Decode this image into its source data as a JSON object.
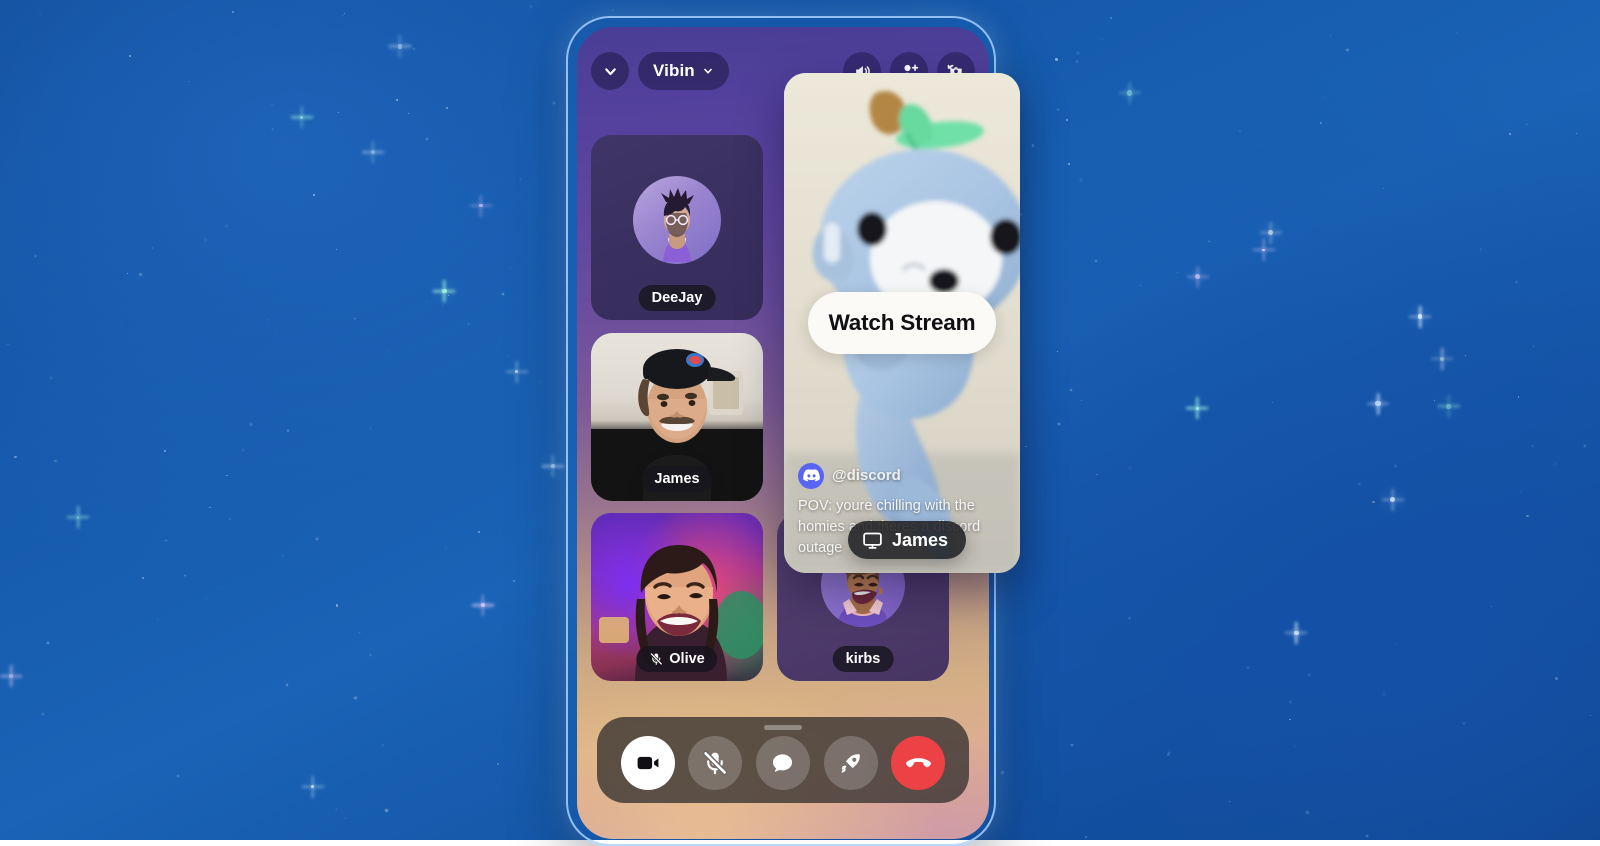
{
  "app": {
    "platform": "mobile-video-call",
    "accent_green": "#7ae495",
    "brand_blurple": "#5865F2",
    "danger_red": "#ed4245"
  },
  "background": {
    "style": "starfield",
    "base_color": "#1559ab"
  },
  "header": {
    "collapse_icon": "chevron-down-icon",
    "server_name": "Vibin",
    "server_dropdown_icon": "chevron-down-icon",
    "actions": [
      {
        "name": "speaker-icon",
        "label": "Speaker"
      },
      {
        "name": "add-person-icon",
        "label": "Invite"
      },
      {
        "name": "flip-camera-icon",
        "label": "Flip Camera"
      }
    ]
  },
  "participants": [
    {
      "name": "DeeJay",
      "kind": "avatar",
      "speaking": false,
      "muted": false
    },
    {
      "name": "James",
      "kind": "video",
      "speaking": true,
      "muted": false
    },
    {
      "name": "Olive",
      "kind": "video",
      "speaking": false,
      "muted": true,
      "mute_icon": "mic-muted-icon"
    },
    {
      "name": "kirbs",
      "kind": "avatar",
      "speaking": true,
      "muted": false
    }
  ],
  "stream": {
    "watch_button_label": "Watch Stream",
    "handle": "@discord",
    "avatar_icon": "discord-logo-icon",
    "caption": "POV: youre chilling with the homies and theres a discord outage",
    "screenshare_badge": {
      "icon": "screen-share-icon",
      "label": "James"
    }
  },
  "controls": [
    {
      "name": "camera-button",
      "icon": "video-camera-icon",
      "state": "active",
      "label": "Camera"
    },
    {
      "name": "mic-button",
      "icon": "mic-muted-icon",
      "state": "muted",
      "label": "Microphone"
    },
    {
      "name": "chat-button",
      "icon": "chat-bubble-icon",
      "state": "default",
      "label": "Chat"
    },
    {
      "name": "activities-button",
      "icon": "rocket-icon",
      "state": "default",
      "label": "Activities"
    },
    {
      "name": "hangup-button",
      "icon": "phone-hangup-icon",
      "state": "danger",
      "label": "Leave Call"
    }
  ]
}
